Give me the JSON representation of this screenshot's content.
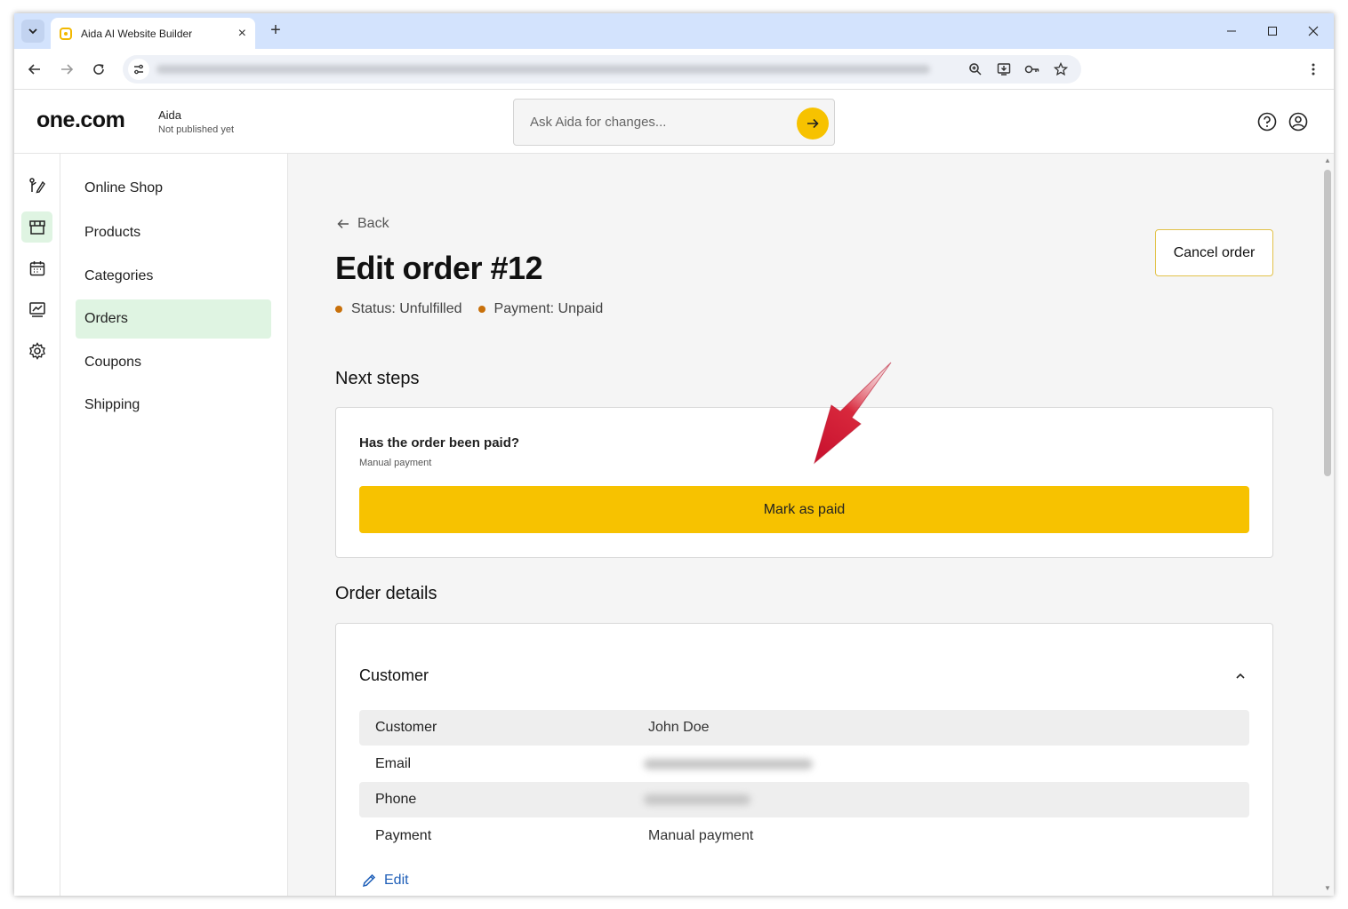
{
  "browser": {
    "tab_title": "Aida AI Website Builder",
    "new_tab_symbol": "+",
    "close_tab_symbol": "×"
  },
  "header": {
    "logo": "one.com",
    "site_name": "Aida",
    "site_status": "Not published yet",
    "ask_placeholder": "Ask Aida for changes..."
  },
  "rail": {
    "items": [
      {
        "icon": "edit-path-icon"
      },
      {
        "icon": "store-icon",
        "active": true
      },
      {
        "icon": "calendar-icon"
      },
      {
        "icon": "analytics-icon"
      },
      {
        "icon": "gear-icon"
      }
    ]
  },
  "subnav": {
    "items": [
      {
        "label": "Online Shop"
      },
      {
        "label": "Products"
      },
      {
        "label": "Categories"
      },
      {
        "label": "Orders",
        "active": true
      },
      {
        "label": "Coupons"
      },
      {
        "label": "Shipping"
      }
    ]
  },
  "page": {
    "back_label": "Back",
    "title": "Edit order #12",
    "status": "Status: Unfulfilled",
    "payment": "Payment: Unpaid",
    "cancel_label": "Cancel order",
    "status_color": "#c8700a"
  },
  "next_steps": {
    "heading": "Next steps",
    "question": "Has the order been paid?",
    "method": "Manual payment",
    "button_label": "Mark as paid",
    "button_color": "#f7c200"
  },
  "order_details": {
    "heading": "Order details",
    "section_title": "Customer",
    "rows": [
      {
        "key": "Customer",
        "value": "John Doe"
      },
      {
        "key": "Email",
        "value": ""
      },
      {
        "key": "Phone",
        "value": ""
      },
      {
        "key": "Payment",
        "value": "Manual payment"
      }
    ],
    "edit_label": "Edit"
  }
}
